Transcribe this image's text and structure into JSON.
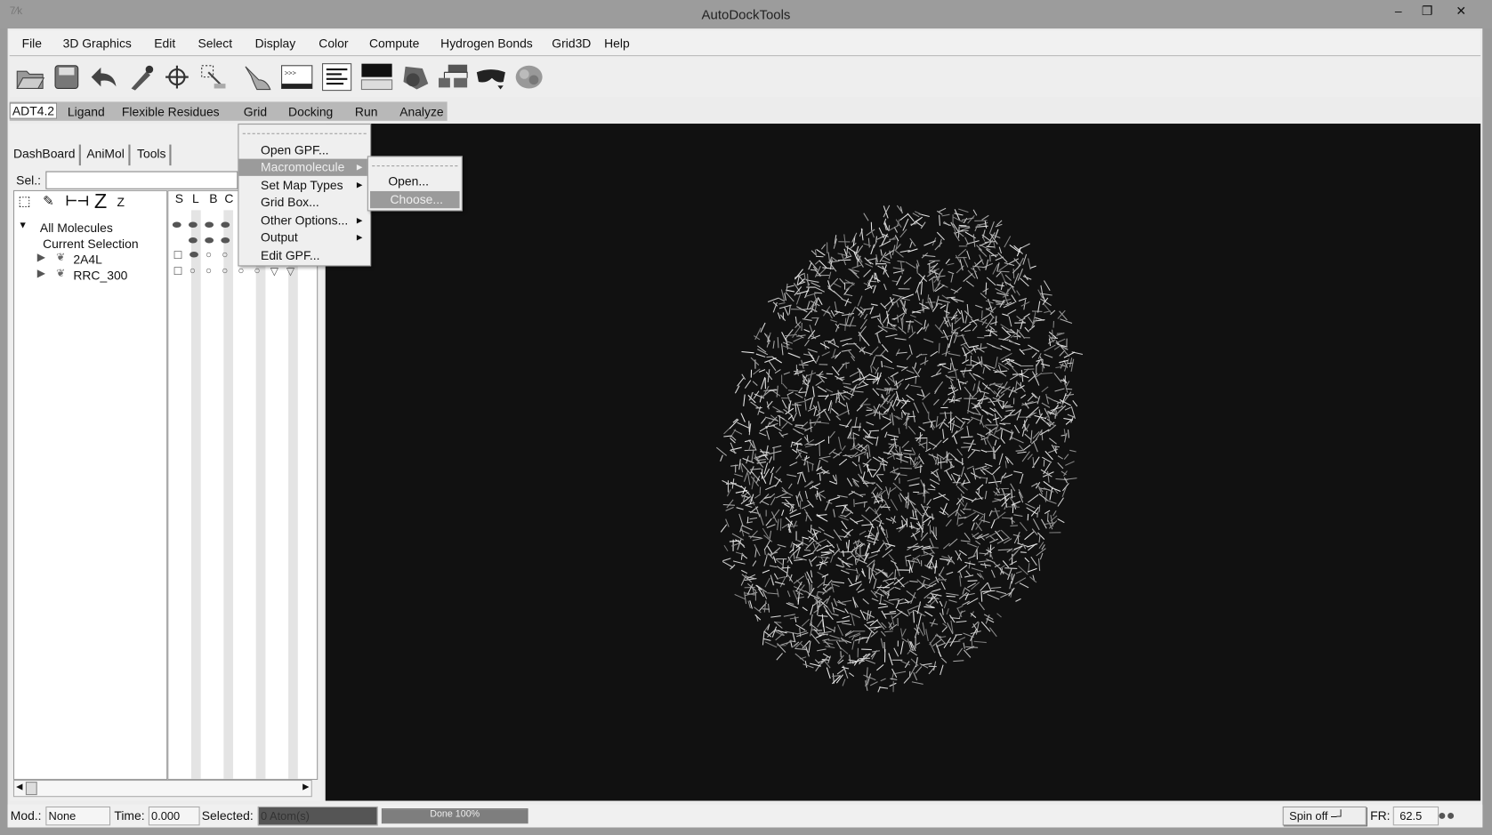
{
  "window": {
    "title": "AutoDockTools",
    "app_icon": "tk-feather-icon",
    "controls": {
      "minimize": "–",
      "maximize": "❐",
      "close": "✕"
    }
  },
  "menubar": [
    "File",
    "3D Graphics",
    "Edit",
    "Select",
    "Display",
    "Color",
    "Compute",
    "Hydrogen Bonds",
    "Grid3D",
    "Help"
  ],
  "toolbar": [
    "open-folder-icon",
    "save-icon",
    "undo-icon",
    "dropper-icon",
    "crosshair-icon",
    "select-icon",
    "pointer-hand-icon",
    "python-shell-icon",
    "text-lines-icon",
    "monitor-icon",
    "camera-icon",
    "dashboard-icon",
    "3d-glasses-icon",
    "molecule-surface-icon"
  ],
  "adt_menu": [
    "ADT4.2",
    "Ligand",
    "Flexible Residues",
    "Grid",
    "Docking",
    "Run",
    "Analyze"
  ],
  "panel_tabs": [
    "DashBoard",
    "AniMol",
    "Tools"
  ],
  "selection": {
    "label": "Sel.:",
    "value": ""
  },
  "dashboard_columns": [
    "S",
    "L",
    "B",
    "C"
  ],
  "tree": {
    "root": "All Molecules",
    "current": "Current Selection",
    "molecules": [
      "2A4L",
      "RRC_300"
    ]
  },
  "grid_menu": {
    "items": [
      "Open GPF...",
      "Macromolecule",
      "Set Map Types",
      "Grid Box...",
      "Other Options...",
      "Output",
      "Edit GPF..."
    ],
    "highlighted": "Macromolecule"
  },
  "macromolecule_submenu": {
    "items": [
      "Open...",
      "Choose..."
    ],
    "highlighted": "Choose..."
  },
  "status": {
    "mod_label": "Mod.:",
    "mod_value": "None",
    "time_label": "Time:",
    "time_value": "0.000",
    "selected_label": "Selected:",
    "selected_value": "0 Atom(s)",
    "progress_text": "Done 100%",
    "progress": 100,
    "spin": "Spin off",
    "fr_label": "FR:",
    "fr_value": "62.5"
  },
  "colors": {
    "viewer_bg": "#111111",
    "highlight": "#9b9b9b"
  }
}
